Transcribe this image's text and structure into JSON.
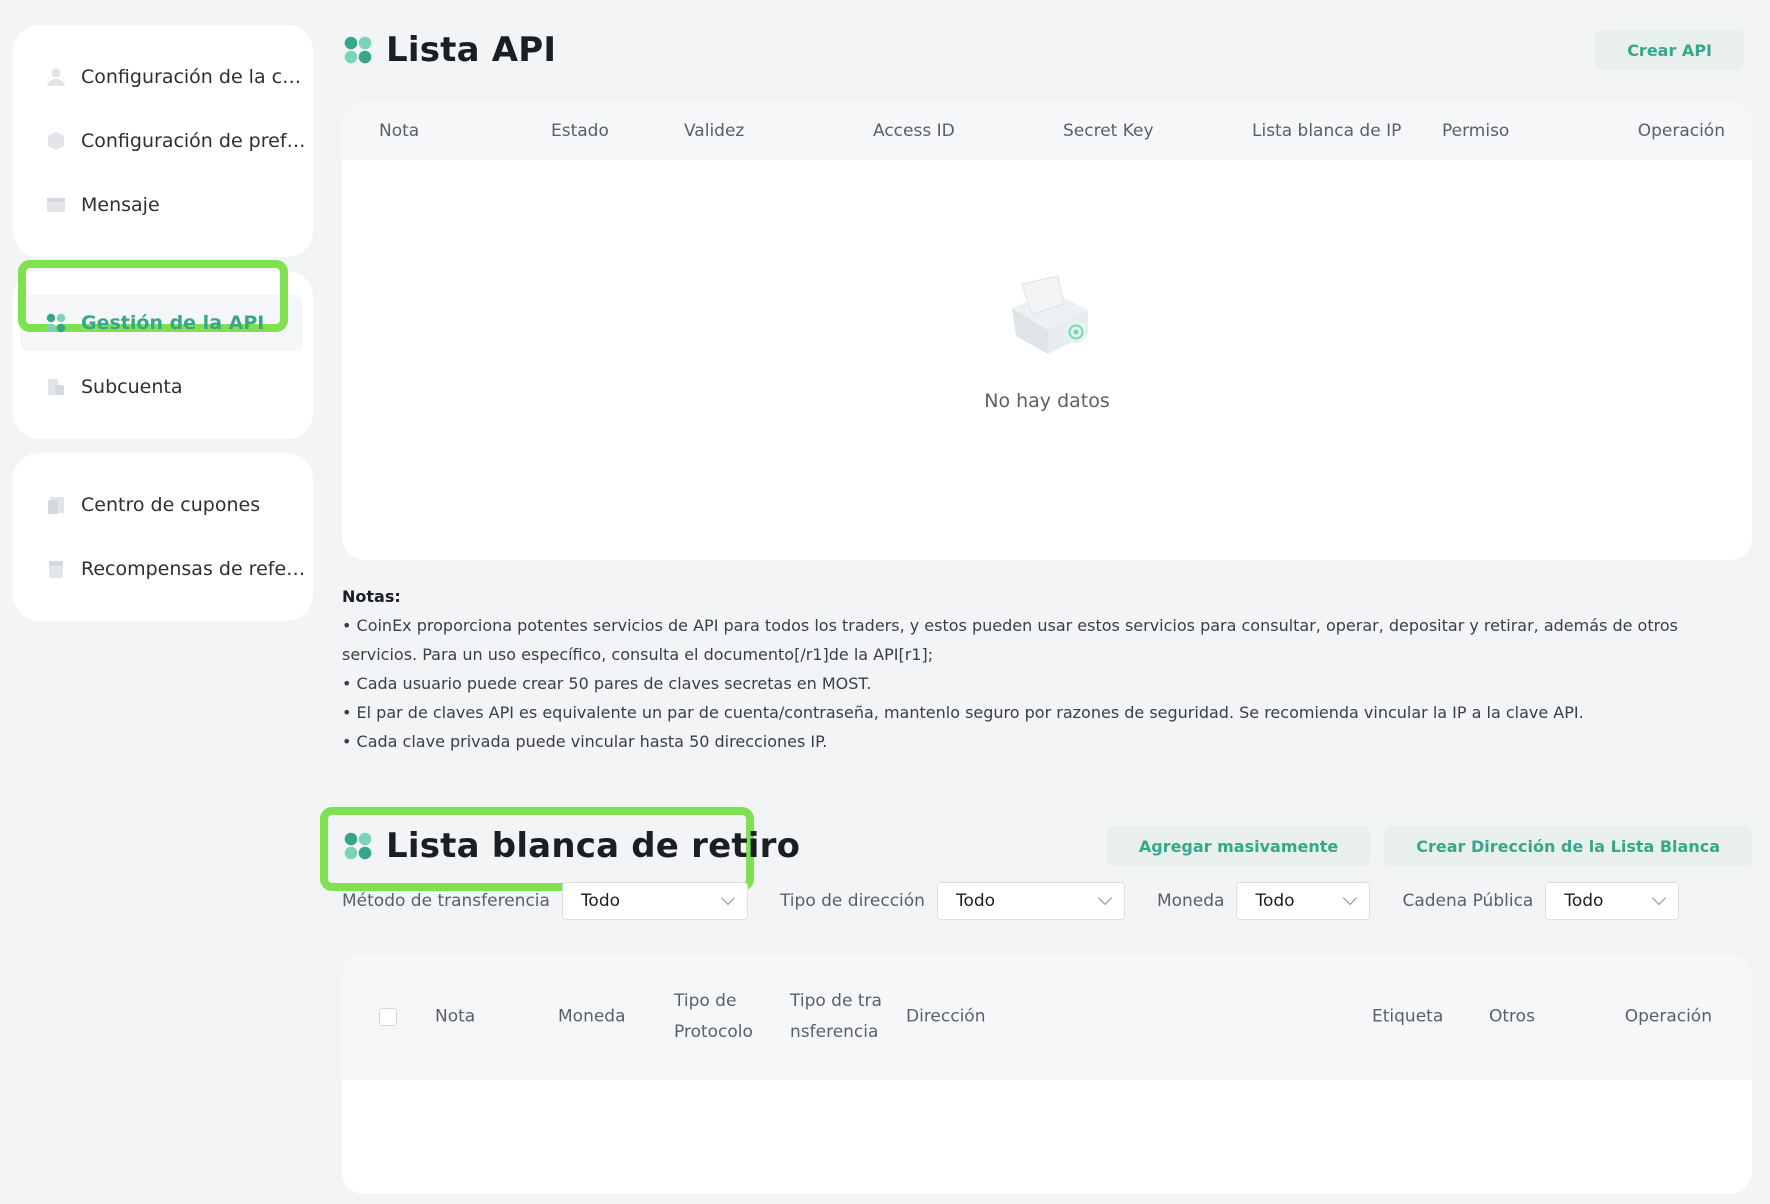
{
  "sidebar": {
    "groups": [
      {
        "items": [
          {
            "label": "Configuración de la cuenta",
            "icon": "user-icon"
          },
          {
            "label": "Configuración de preferencias",
            "icon": "preferences-icon"
          },
          {
            "label": "Mensaje",
            "icon": "message-icon"
          }
        ]
      },
      {
        "items": [
          {
            "label": "Gestión de la API",
            "icon": "api-icon",
            "active": true
          },
          {
            "label": "Subcuenta",
            "icon": "subaccount-icon"
          }
        ]
      },
      {
        "items": [
          {
            "label": "Centro de cupones",
            "icon": "coupon-icon"
          },
          {
            "label": "Recompensas de referidos",
            "icon": "referral-icon"
          }
        ]
      }
    ]
  },
  "api_list": {
    "title": "Lista API",
    "create_button": "Crear API",
    "columns": [
      "Nota",
      "Estado",
      "Validez",
      "Access ID",
      "Secret Key",
      "Lista blanca de IP",
      "Permiso",
      "Operación"
    ],
    "empty_text": "No hay datos"
  },
  "notes": {
    "title": "Notas:",
    "items": [
      "• CoinEx proporciona potentes servicios de API para todos los traders, y estos pueden usar estos servicios para consultar, operar, depositar y retirar, además de otros servicios. Para un uso específico, consulta el documento[/r1]de la API[r1];",
      "• Cada usuario puede crear 50 pares de claves secretas en MOST.",
      "• El par de claves API es equivalente un par de cuenta/contraseña, mantenlo seguro por razones de seguridad. Se recomienda vincular la IP a la clave API.",
      "• Cada clave privada puede vincular hasta 50 direcciones IP."
    ]
  },
  "whitelist": {
    "title": "Lista blanca de retiro",
    "bulk_add_button": "Agregar masivamente",
    "create_button": "Crear Dirección de la Lista Blanca",
    "filters": [
      {
        "label": "Método de transferencia",
        "value": "Todo"
      },
      {
        "label": "Tipo de dirección",
        "value": "Todo"
      },
      {
        "label": "Moneda",
        "value": "Todo"
      },
      {
        "label": "Cadena Pública",
        "value": "Todo"
      }
    ],
    "columns": [
      "Nota",
      "Moneda",
      "Tipo de Protocolo",
      "Tipo de transferencia",
      "Dirección",
      "Etiqueta",
      "Otros",
      "Operación"
    ]
  },
  "colors": {
    "accent": "#36a78a",
    "highlight": "#7fe14f",
    "background": "#f3f4f6"
  }
}
